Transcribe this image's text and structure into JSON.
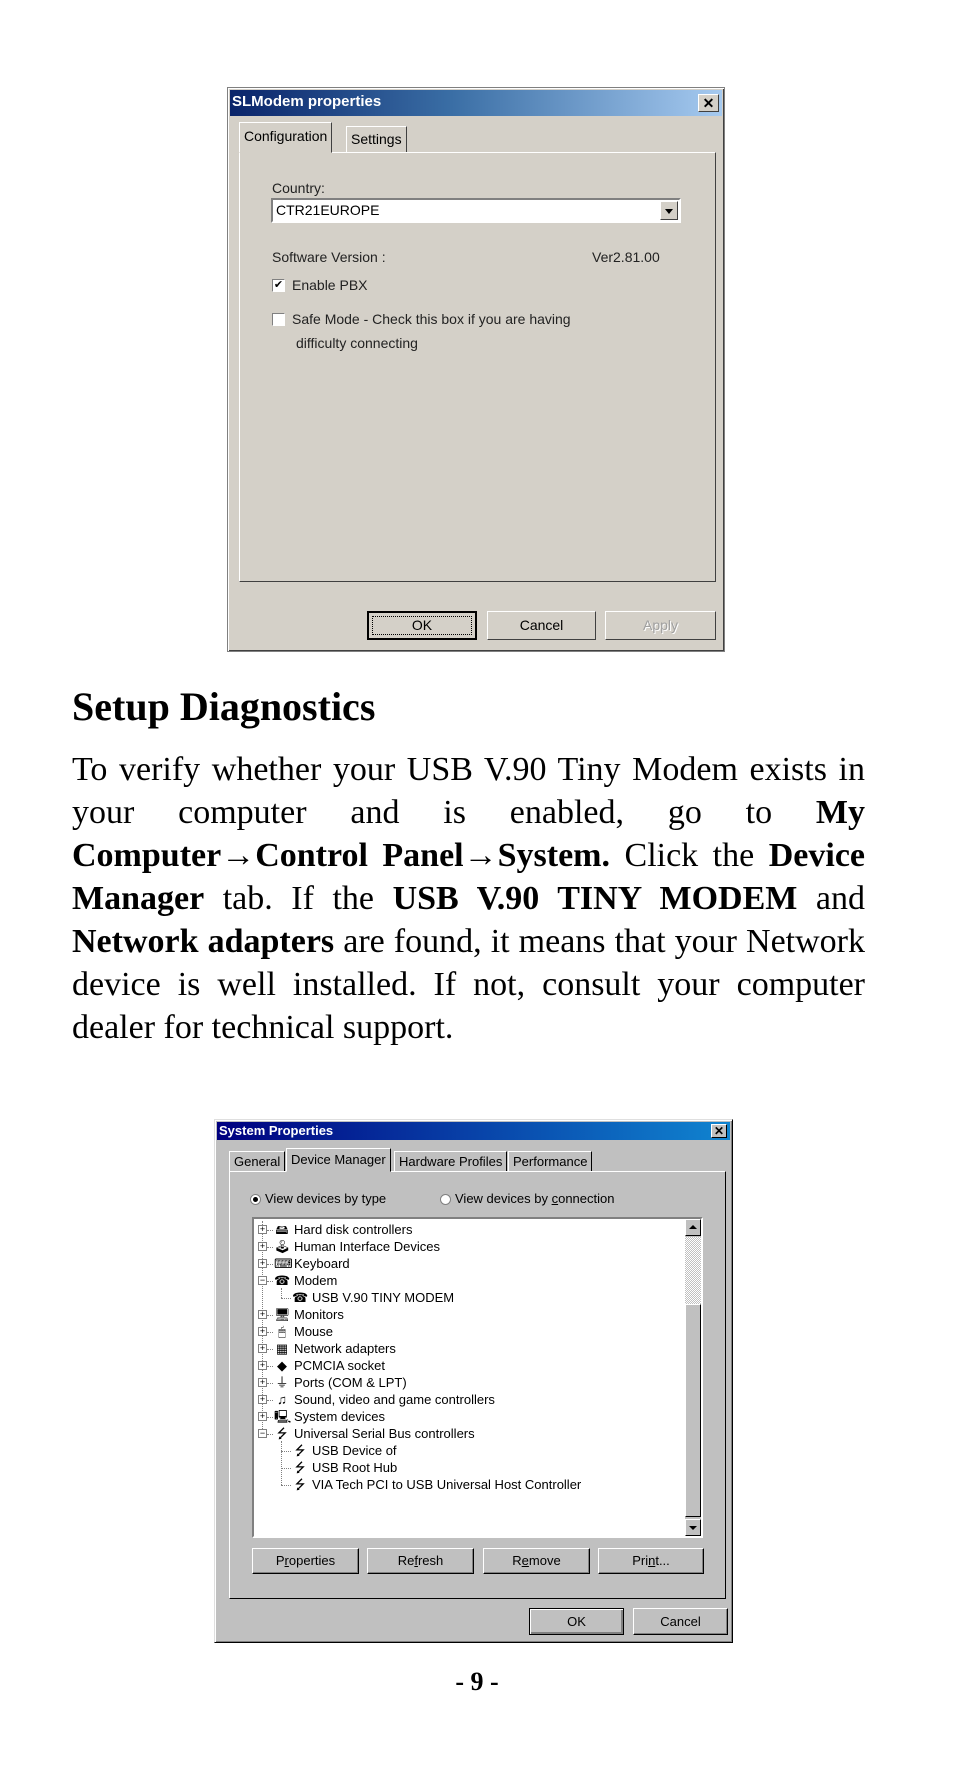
{
  "dialog1": {
    "title": "SLModem properties",
    "close_glyph": "✕",
    "tabs": [
      {
        "label": "Configuration",
        "active": true
      },
      {
        "label": "Settings",
        "active": false
      }
    ],
    "country_label": "Country:",
    "country_value": "CTR21EUROPE",
    "software_version_label": "Software Version :",
    "software_version_value": "Ver2.81.00",
    "enable_pbx": {
      "label": "Enable PBX",
      "checked": true
    },
    "safe_mode": {
      "label_line1": "Safe Mode - Check this box if you are having",
      "label_line2": "difficulty connecting",
      "checked": false
    },
    "buttons": {
      "ok": "OK",
      "cancel": "Cancel",
      "apply": "Apply"
    },
    "check_glyph": "✔"
  },
  "section": {
    "heading": "Setup Diagnostics",
    "body_parts": [
      {
        "text": "To verify whether your USB V.90 Tiny Modem exists in your computer and is enabled, go to ",
        "bold": false
      },
      {
        "text": "My Computer→Control Panel→System.",
        "bold": true
      },
      {
        "text": "  Click the ",
        "bold": false
      },
      {
        "text": "Device Manager",
        "bold": true
      },
      {
        "text": " tab.  If the ",
        "bold": false
      },
      {
        "text": "USB V.90 TINY MODEM",
        "bold": true
      },
      {
        "text": " and ",
        "bold": false
      },
      {
        "text": "Network adapters",
        "bold": true
      },
      {
        "text": " are found, it means that your Network device is well installed.  If not, consult your computer dealer for technical support.",
        "bold": false
      }
    ]
  },
  "dialog2": {
    "title": "System Properties",
    "help_glyph": "?",
    "close_glyph": "✕",
    "tabs": [
      {
        "label": "General",
        "active": false
      },
      {
        "label": "Device Manager",
        "active": true
      },
      {
        "label": "Hardware Profiles",
        "active": false
      },
      {
        "label": "Performance",
        "active": false
      }
    ],
    "view_by_type": {
      "label": "View devices by type",
      "selected": true
    },
    "view_by_connection": {
      "label": "View devices by connection",
      "selected": false
    },
    "tree": [
      {
        "label": "Hard disk controllers",
        "level": 0,
        "expander": "+",
        "icon": "hard-disk-icon",
        "glyph": "🖴"
      },
      {
        "label": "Human Interface Devices",
        "level": 0,
        "expander": "+",
        "icon": "hid-icon",
        "glyph": "🕹"
      },
      {
        "label": "Keyboard",
        "level": 0,
        "expander": "+",
        "icon": "keyboard-icon",
        "glyph": "⌨"
      },
      {
        "label": "Modem",
        "level": 0,
        "expander": "−",
        "icon": "modem-icon",
        "glyph": "☎"
      },
      {
        "label": "USB V.90 TINY MODEM",
        "level": 1,
        "expander": "",
        "icon": "modem-icon",
        "glyph": "☎"
      },
      {
        "label": "Monitors",
        "level": 0,
        "expander": "+",
        "icon": "monitor-icon",
        "glyph": "🖥"
      },
      {
        "label": "Mouse",
        "level": 0,
        "expander": "+",
        "icon": "mouse-icon",
        "glyph": "🖱"
      },
      {
        "label": "Network adapters",
        "level": 0,
        "expander": "+",
        "icon": "network-adapter-icon",
        "glyph": "▦"
      },
      {
        "label": "PCMCIA socket",
        "level": 0,
        "expander": "+",
        "icon": "pcmcia-icon",
        "glyph": "◆"
      },
      {
        "label": "Ports (COM & LPT)",
        "level": 0,
        "expander": "+",
        "icon": "port-icon",
        "glyph": "⏚"
      },
      {
        "label": "Sound, video and game controllers",
        "level": 0,
        "expander": "+",
        "icon": "sound-icon",
        "glyph": "♫"
      },
      {
        "label": "System devices",
        "level": 0,
        "expander": "+",
        "icon": "system-device-icon",
        "glyph": "🖳"
      },
      {
        "label": "Universal Serial Bus controllers",
        "level": 0,
        "expander": "−",
        "icon": "usb-icon",
        "glyph": "⭍"
      },
      {
        "label": "USB Device of",
        "level": 1,
        "expander": "",
        "icon": "usb-icon",
        "glyph": "⭍"
      },
      {
        "label": "USB Root Hub",
        "level": 1,
        "expander": "",
        "icon": "usb-icon",
        "glyph": "⭍"
      },
      {
        "label": "VIA Tech PCI to USB Universal Host Controller",
        "level": 1,
        "expander": "",
        "icon": "usb-icon",
        "glyph": "⭍"
      }
    ],
    "scroll_position": "bottom",
    "action_buttons": {
      "properties": "Properties",
      "refresh": "Refresh",
      "remove": "Remove",
      "print": "Print..."
    },
    "buttons": {
      "ok": "OK",
      "cancel": "Cancel"
    }
  },
  "page_number": "- 9 -"
}
